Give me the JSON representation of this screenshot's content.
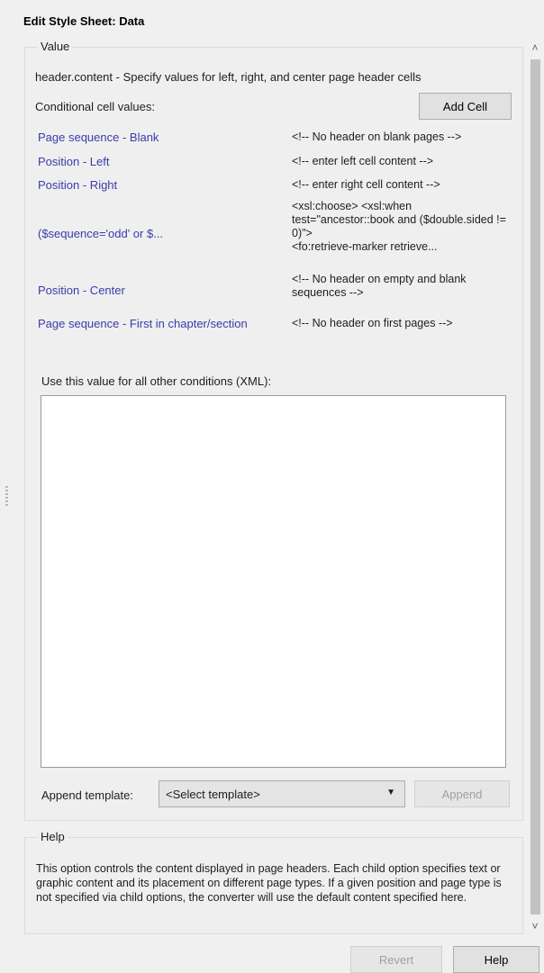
{
  "dialog": {
    "title": "Edit Style Sheet: Data"
  },
  "value_group": {
    "legend": "Value",
    "description": "header.content - Specify values for left, right, and center page header cells",
    "conditional_label": "Conditional cell values:",
    "add_cell_label": "Add Cell",
    "conditions": [
      {
        "name": "Page sequence - Blank",
        "value": "<!-- No header on blank pages -->"
      },
      {
        "name": "Position - Left",
        "value": "<!-- enter left cell content -->"
      },
      {
        "name": "Position - Right",
        "value": "<!-- enter right cell content -->"
      },
      {
        "name": "($sequence='odd' or $...",
        "value": "<xsl:choose>            <xsl:when test=\"ancestor::book and ($double.sided != 0)\">\n<fo:retrieve-marker retrieve..."
      },
      {
        "name": "Position - Center",
        "value": "<!-- No header on empty and blank sequences -->"
      },
      {
        "name": "Page sequence - First in chapter/section",
        "value": "<!-- No header on first pages -->"
      }
    ],
    "default_label": "Use this value for all other conditions (XML):",
    "default_value": "",
    "append_label": "Append template:",
    "template_selected": "<Select template>",
    "append_button": "Append"
  },
  "help_group": {
    "legend": "Help",
    "text": "This option controls the content displayed in page headers.  Each child option specifies text or graphic content and its placement on different page types. If a given position and page type is not specified via child options, the converter will use the default content specified here."
  },
  "footer": {
    "revert_label": "Revert",
    "help_label": "Help"
  },
  "icons": {
    "scroll_up": "chevron-up-icon",
    "scroll_down": "chevron-down-icon",
    "dropdown": "dropdown-arrow-icon"
  }
}
